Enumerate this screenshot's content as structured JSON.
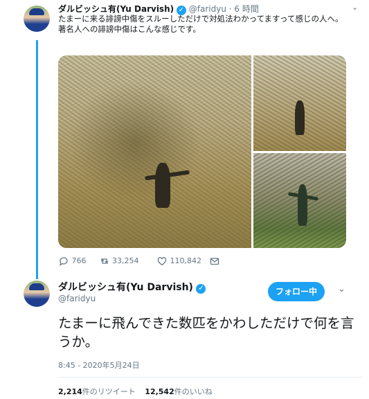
{
  "tweet1": {
    "display_name": "ダルビッシュ有(Yu Darvish)",
    "handle": "@faridyu",
    "time": "· 6 時間",
    "text_lines": [
      "たまーに来る誹謗中傷をスルーしただけで対処法わかってますって感じの人へ。",
      "著名人への誹謗中傷はこんな感じです。"
    ],
    "actions": {
      "replies": "766",
      "retweets": "33,254",
      "likes": "110,842"
    }
  },
  "tweet2": {
    "display_name": "ダルビッシュ有(Yu Darvish)",
    "handle": "@faridyu",
    "follow_label": "フォロー中",
    "text": "たまーに飛んできた数匹をかわしただけで何を言うか。",
    "timestamp": "8:45 - 2020年5月24日",
    "retweet_count": "2,214",
    "retweet_label": "件のリツイート",
    "like_count": "12,542",
    "like_label": "件のいいね"
  },
  "colors": {
    "accent": "#1da1f2",
    "muted": "#657786"
  }
}
